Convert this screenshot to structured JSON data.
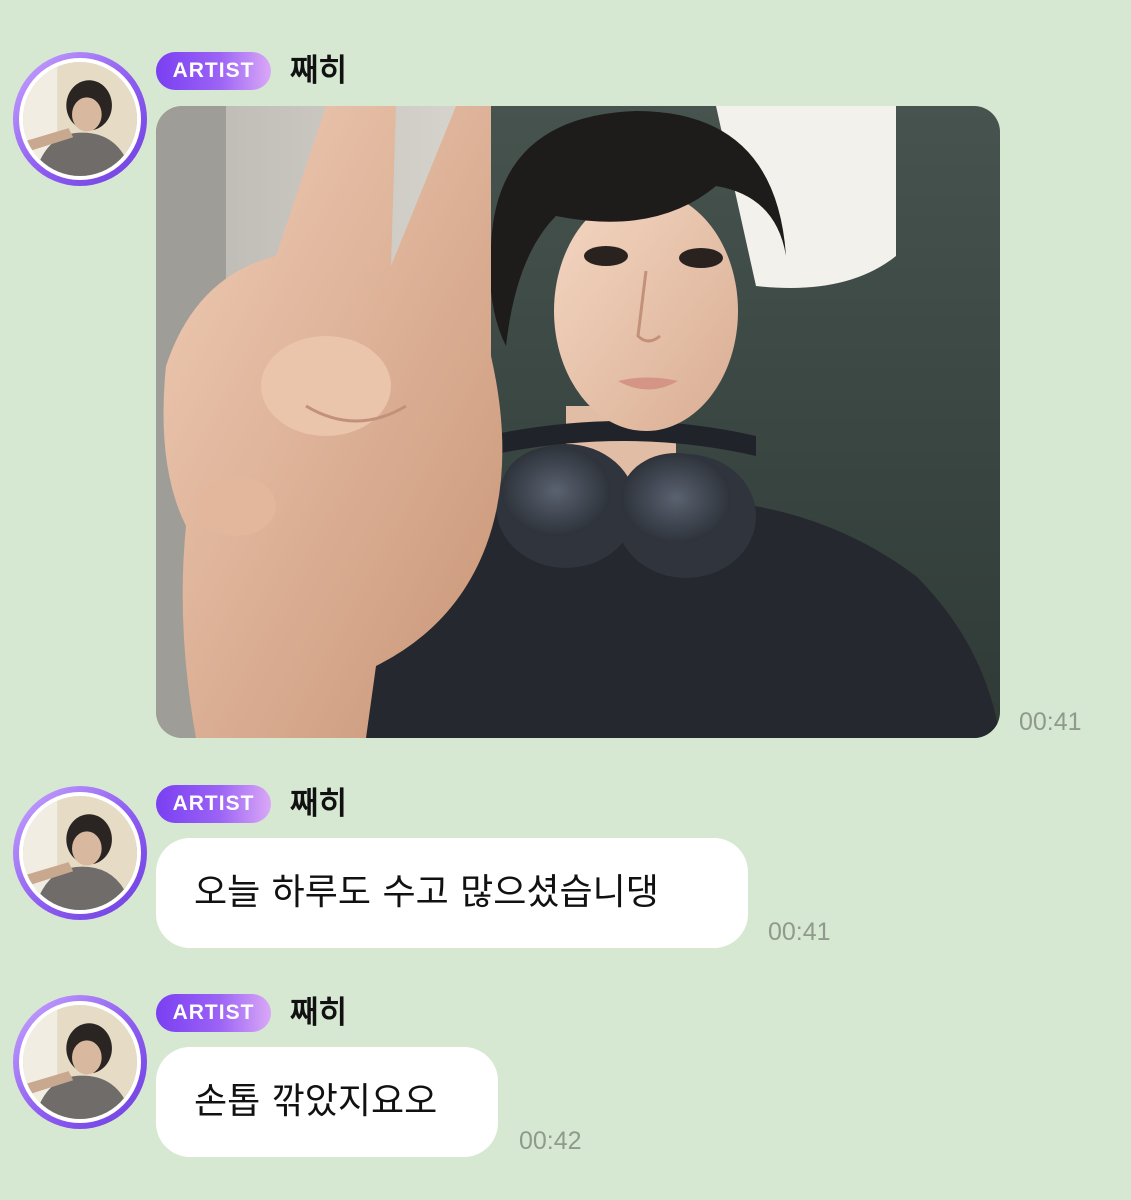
{
  "messages": [
    {
      "badge": "ARTIST",
      "sender": "째히",
      "type": "image",
      "image_description_icon": "selfie-photo",
      "time": "00:41"
    },
    {
      "badge": "ARTIST",
      "sender": "째히",
      "type": "text",
      "text": "오늘 하루도 수고 많으셨습니댕",
      "time": "00:41"
    },
    {
      "badge": "ARTIST",
      "sender": "째히",
      "type": "text",
      "text": "손톱 깎았지요오",
      "time": "00:42"
    }
  ],
  "colors": {
    "background": "#d6e8d2",
    "badge_start": "#7a3ff2",
    "badge_end": "#d9a8f7",
    "bubble": "#ffffff",
    "timestamp": "#8f9a8c"
  }
}
